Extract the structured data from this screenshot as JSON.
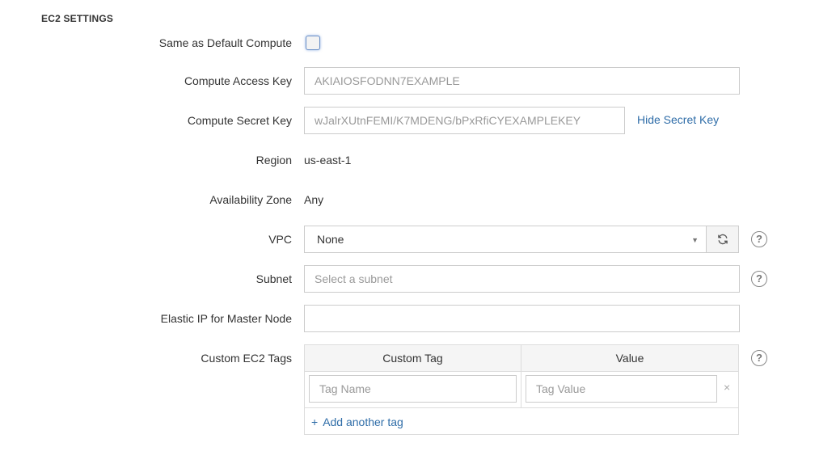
{
  "section": {
    "title": "EC2 SETTINGS"
  },
  "fields": {
    "same_as_default": {
      "label": "Same as Default Compute",
      "checked": false
    },
    "access_key": {
      "label": "Compute Access Key",
      "value": "AKIAIOSFODNN7EXAMPLE"
    },
    "secret_key": {
      "label": "Compute Secret Key",
      "value": "wJalrXUtnFEMI/K7MDENG/bPxRfiCYEXAMPLEKEY",
      "toggle_link": "Hide Secret Key"
    },
    "region": {
      "label": "Region",
      "value": "us-east-1"
    },
    "availability_zone": {
      "label": "Availability Zone",
      "value": "Any"
    },
    "vpc": {
      "label": "VPC",
      "selected": "None"
    },
    "subnet": {
      "label": "Subnet",
      "placeholder": "Select a subnet"
    },
    "elastic_ip": {
      "label": "Elastic IP for Master Node",
      "value": ""
    },
    "custom_tags": {
      "label": "Custom EC2 Tags",
      "columns": [
        "Custom Tag",
        "Value"
      ],
      "rows": [
        {
          "name_placeholder": "Tag Name",
          "value_placeholder": "Tag Value",
          "remove": "×"
        }
      ],
      "add_link": "Add another tag",
      "add_icon": "+"
    }
  },
  "help_icon": "?",
  "colors": {
    "link": "#2f6da8",
    "border": "#cccccc",
    "placeholder": "#999999"
  }
}
